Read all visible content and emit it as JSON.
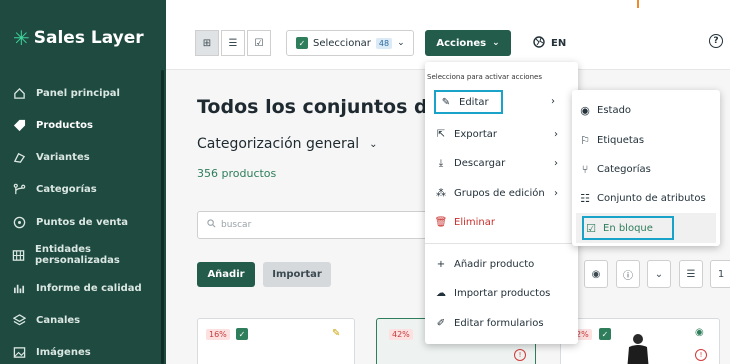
{
  "brand": {
    "name": "Sales Layer",
    "accent": "#3fd39b"
  },
  "sidebar": {
    "items": [
      {
        "label": "Panel principal",
        "icon": "home-icon"
      },
      {
        "label": "Productos",
        "icon": "tag-icon",
        "active": true
      },
      {
        "label": "Variantes",
        "icon": "variants-icon"
      },
      {
        "label": "Categorías",
        "icon": "branch-icon"
      },
      {
        "label": "Puntos de venta",
        "icon": "location-icon"
      },
      {
        "label": "Entidades personalizadas",
        "icon": "grid-icon"
      },
      {
        "label": "Informe de calidad",
        "icon": "bar-chart-icon"
      },
      {
        "label": "Canales",
        "icon": "layers-icon"
      },
      {
        "label": "Imágenes",
        "icon": "image-icon"
      }
    ]
  },
  "toolbar": {
    "select_label": "Seleccionar",
    "select_count": "48",
    "actions_label": "Acciones",
    "language": "EN",
    "help": "?"
  },
  "main": {
    "title": "Todos los conjuntos de atributos",
    "subtitle": "Categorización general",
    "count": "356 productos",
    "search_placeholder": "buscar",
    "add_label": "Añadir",
    "import_label": "Importar",
    "page_number": "1"
  },
  "cards": [
    {
      "discount": "16%"
    },
    {
      "discount": "42%"
    },
    {
      "discount": "2%"
    }
  ],
  "menu": {
    "hint": "Selecciona para activar acciones",
    "items": [
      {
        "label": "Editar",
        "icon": "pencil-icon",
        "has_submenu": true,
        "highlighted": true
      },
      {
        "label": "Exportar",
        "icon": "export-icon",
        "has_submenu": true
      },
      {
        "label": "Descargar",
        "icon": "download-icon",
        "has_submenu": true
      },
      {
        "label": "Grupos de edición",
        "icon": "group-icon",
        "has_submenu": true
      },
      {
        "label": "Eliminar",
        "icon": "trash-icon",
        "danger": true
      },
      {
        "label": "Añadir producto",
        "icon": "plus-icon"
      },
      {
        "label": "Importar productos",
        "icon": "cloud-upload-icon"
      },
      {
        "label": "Editar formularios",
        "icon": "pencil-line-icon"
      }
    ]
  },
  "submenu": {
    "items": [
      {
        "label": "Estado",
        "icon": "eye-icon"
      },
      {
        "label": "Etiquetas",
        "icon": "bookmark-icon"
      },
      {
        "label": "Categorías",
        "icon": "branch-icon"
      },
      {
        "label": "Conjunto de atributos",
        "icon": "list-icon"
      },
      {
        "label": "En bloque",
        "icon": "edit-box-icon",
        "highlighted": true
      }
    ]
  },
  "colors": {
    "primary": "#245c4c",
    "sidebar": "#1e4a40",
    "highlight_border": "#1aa3c9",
    "danger": "#c9302c"
  }
}
